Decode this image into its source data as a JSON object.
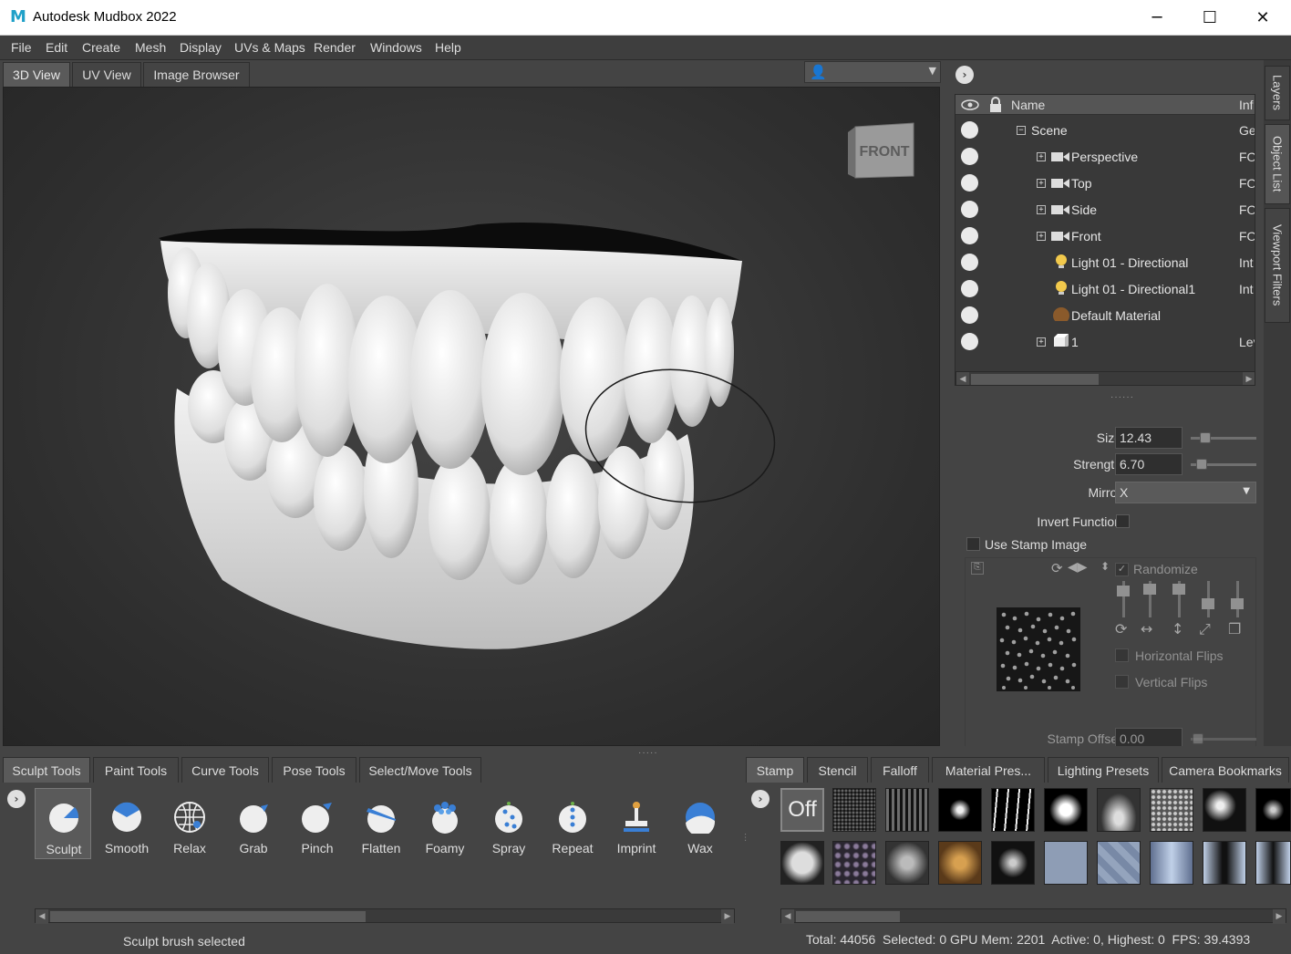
{
  "window": {
    "title": "Autodesk Mudbox 2022",
    "app_icon": "M",
    "minimize": "─",
    "maximize": "☐",
    "close": "✕"
  },
  "menu": [
    "File",
    "Edit",
    "Create",
    "Mesh",
    "Display",
    "UVs & Maps",
    "Render",
    "Windows",
    "Help"
  ],
  "view_tabs": [
    "3D View",
    "UV View",
    "Image Browser"
  ],
  "viewport": {
    "cube_label": "FRONT"
  },
  "side_tabs": [
    "Layers",
    "Object List",
    "Viewport Filters"
  ],
  "object_list": {
    "columns": {
      "name": "Name",
      "info": "Inf"
    },
    "rows": [
      {
        "name": "Scene",
        "info": "Ge",
        "icon": "scene-icon"
      },
      {
        "name": "Perspective",
        "info": "FO",
        "icon": "camera-icon"
      },
      {
        "name": "Top",
        "info": "FO",
        "icon": "camera-icon"
      },
      {
        "name": "Side",
        "info": "FO",
        "icon": "camera-icon"
      },
      {
        "name": "Front",
        "info": "FO",
        "icon": "camera-icon"
      },
      {
        "name": "Light 01 - Directional",
        "info": "Int",
        "icon": "light-icon"
      },
      {
        "name": "Light 01 - Directional1",
        "info": "Int",
        "icon": "light-icon"
      },
      {
        "name": "Default Material",
        "info": "",
        "icon": "material-icon"
      },
      {
        "name": "1",
        "info": "Lev",
        "icon": "mesh-icon"
      }
    ]
  },
  "properties": {
    "size_label": "Size",
    "size_value": "12.43",
    "strength_label": "Strength",
    "strength_value": "6.70",
    "mirror_label": "Mirror",
    "mirror_value": "X",
    "invert_label": "Invert Function",
    "use_stamp_label": "Use Stamp Image",
    "randomize_label": "Randomize",
    "hflips_label": "Horizontal Flips",
    "vflips_label": "Vertical Flips",
    "stamp_offset_label": "Stamp Offset",
    "stamp_offset_value": "0.00"
  },
  "tool_tabs": [
    "Sculpt Tools",
    "Paint Tools",
    "Curve Tools",
    "Pose Tools",
    "Select/Move Tools"
  ],
  "tools": [
    "Sculpt",
    "Smooth",
    "Relax",
    "Grab",
    "Pinch",
    "Flatten",
    "Foamy",
    "Spray",
    "Repeat",
    "Imprint",
    "Wax"
  ],
  "stamp_tabs": [
    "Stamp",
    "Stencil",
    "Falloff",
    "Material Pres...",
    "Lighting Presets",
    "Camera Bookmarks"
  ],
  "stamp_off_label": "Off",
  "status": {
    "left": "Sculpt brush selected",
    "right": "Total: 44056  Selected: 0 GPU Mem: 2201  Active: 0, Highest: 0  FPS: 39.4393"
  }
}
